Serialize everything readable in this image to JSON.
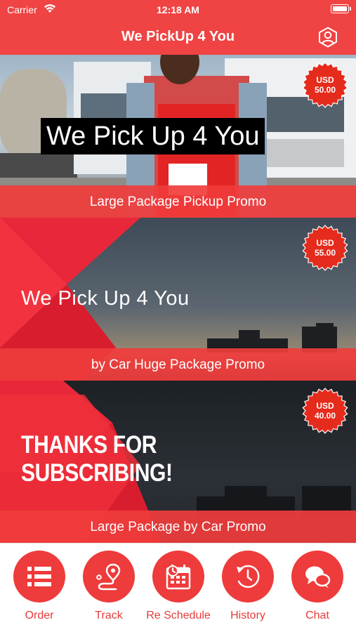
{
  "status_bar": {
    "carrier": "Carrier",
    "time": "12:18 AM"
  },
  "header": {
    "title": "We PickUp 4 You",
    "profile_icon": "user-hexagon-icon"
  },
  "promos": [
    {
      "banner_text": "We Pick Up 4 You",
      "label": "Large Package Pickup Promo",
      "price_currency": "USD",
      "price_value": "50.00"
    },
    {
      "banner_text": "We Pick Up 4 You",
      "label": "by Car Huge Package Promo",
      "price_currency": "USD",
      "price_value": "55.00"
    },
    {
      "banner_line1": "THANKS FOR",
      "banner_line2": "SUBSCRIBING!",
      "label": "Large Package by Car Promo",
      "price_currency": "USD",
      "price_value": "40.00"
    }
  ],
  "tabs": [
    {
      "label": "Order",
      "icon": "list-icon"
    },
    {
      "label": "Track",
      "icon": "map-pin-route-icon"
    },
    {
      "label": "Re Schedule",
      "icon": "calendar-clock-icon"
    },
    {
      "label": "History",
      "icon": "history-icon"
    },
    {
      "label": "Chat",
      "icon": "chat-bubbles-icon"
    }
  ],
  "colors": {
    "brand_red": "#f04343",
    "badge_red": "#e52b1c",
    "tab_label": "#e53b3b"
  }
}
